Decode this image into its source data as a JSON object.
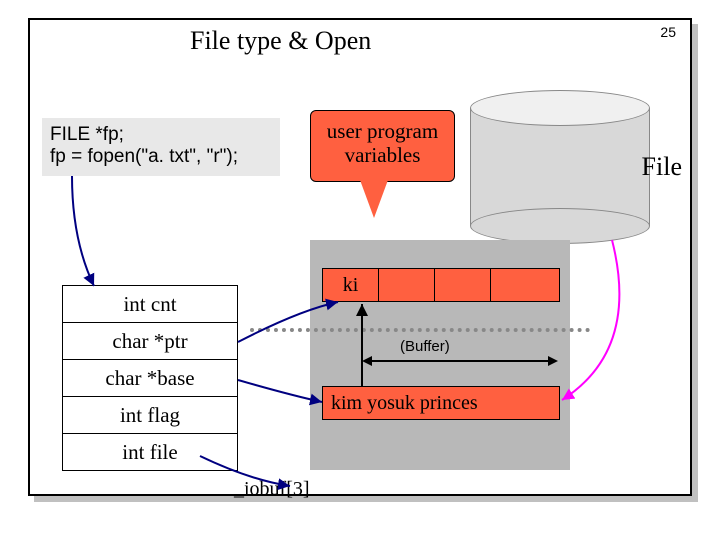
{
  "title": "File type & Open",
  "pagenum": "25",
  "code": {
    "line1": "FILE *fp;",
    "line2": "fp = fopen(\"a. txt\", \"r\");"
  },
  "callout": {
    "line1": "user program",
    "line2": "variables"
  },
  "file_label": "File",
  "struct": {
    "rows": [
      "int cnt",
      "char *ptr",
      "char *base",
      "int flag",
      "int file"
    ]
  },
  "ki_text": "ki",
  "buffer_label": "(Buffer)",
  "kim_text": "kim yosuk princes",
  "iobuf_label": "_iobuf[3]"
}
